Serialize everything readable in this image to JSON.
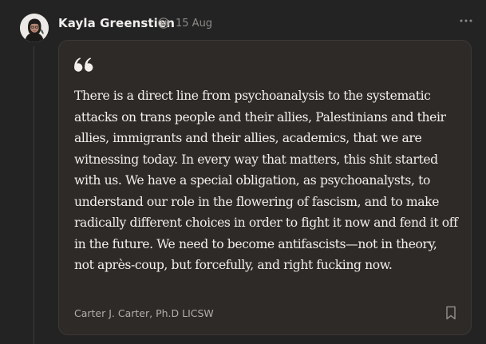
{
  "post": {
    "author": "Kayla Greenstien",
    "timestamp": "15 Aug",
    "avatar_icon": "profile-photo",
    "badge_icon": "subscriber-badge-icon",
    "more_icon": "ellipsis-horizontal-icon"
  },
  "quote": {
    "icon": "quote-mark-icon",
    "text": "There is a direct line from psychoanalysis to the systematic attacks on trans people and their allies, Palestinians and their allies, immigrants and their allies, academics, that we are witnessing today. In every way that matters, this shit started with us. We have a special obligation, as psychoanalysts, to understand our role in the flowering of fascism, and to make radically different choices in order to fight it now and fend it off in the future. We need to become antifascists—not in theory, not après-coup, but forcefully, and right fucking now.",
    "attribution": "Carter J. Carter, Ph.D LICSW",
    "bookmark_icon": "bookmark-icon"
  },
  "colors": {
    "background": "#232323",
    "card_background": "#2e2a28",
    "card_border": "#3d3835",
    "text_primary": "#f2efec",
    "text_secondary": "#8d8a87"
  }
}
